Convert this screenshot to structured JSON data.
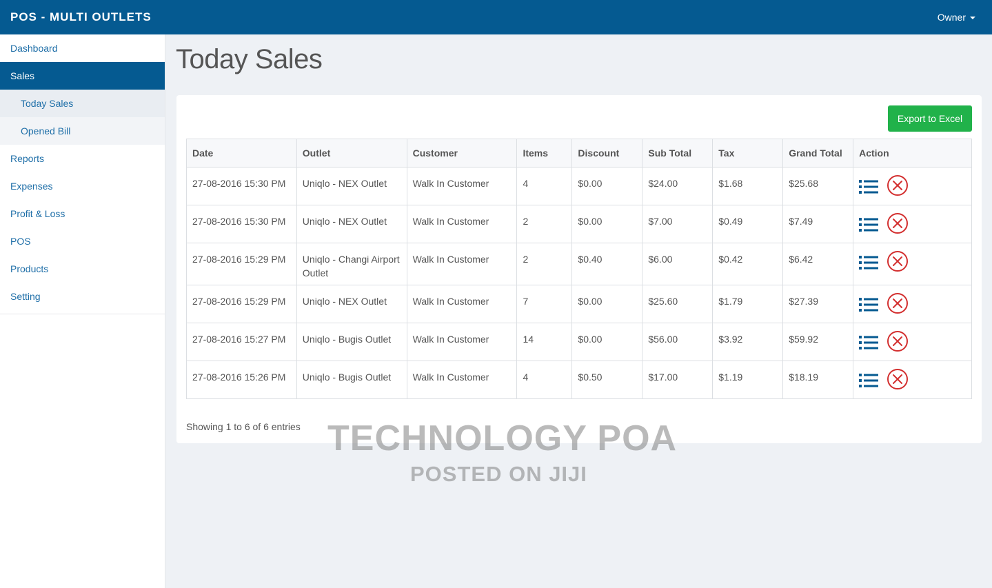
{
  "header": {
    "brand": "POS - MULTI OUTLETS",
    "user": "Owner"
  },
  "sidebar": {
    "items": [
      {
        "label": "Dashboard"
      },
      {
        "label": "Sales"
      },
      {
        "label": "Today Sales"
      },
      {
        "label": "Opened Bill"
      },
      {
        "label": "Reports"
      },
      {
        "label": "Expenses"
      },
      {
        "label": "Profit & Loss"
      },
      {
        "label": "POS"
      },
      {
        "label": "Products"
      },
      {
        "label": "Setting"
      }
    ]
  },
  "main": {
    "title": "Today Sales",
    "export_label": "Export to Excel",
    "table": {
      "headers": [
        "Date",
        "Outlet",
        "Customer",
        "Items",
        "Discount",
        "Sub Total",
        "Tax",
        "Grand Total",
        "Action"
      ],
      "rows": [
        [
          "27-08-2016 15:30 PM",
          "Uniqlo - NEX Outlet",
          "Walk In Customer",
          "4",
          "$0.00",
          "$24.00",
          "$1.68",
          "$25.68"
        ],
        [
          "27-08-2016 15:30 PM",
          "Uniqlo - NEX Outlet",
          "Walk In Customer",
          "2",
          "$0.00",
          "$7.00",
          "$0.49",
          "$7.49"
        ],
        [
          "27-08-2016 15:29 PM",
          "Uniqlo - Changi Airport Outlet",
          "Walk In Customer",
          "2",
          "$0.40",
          "$6.00",
          "$0.42",
          "$6.42"
        ],
        [
          "27-08-2016 15:29 PM",
          "Uniqlo - NEX Outlet",
          "Walk In Customer",
          "7",
          "$0.00",
          "$25.60",
          "$1.79",
          "$27.39"
        ],
        [
          "27-08-2016 15:27 PM",
          "Uniqlo - Bugis Outlet",
          "Walk In Customer",
          "14",
          "$0.00",
          "$56.00",
          "$3.92",
          "$59.92"
        ],
        [
          "27-08-2016 15:26 PM",
          "Uniqlo - Bugis Outlet",
          "Walk In Customer",
          "4",
          "$0.50",
          "$17.00",
          "$1.19",
          "$18.19"
        ]
      ]
    },
    "showing": "Showing 1 to 6 of 6 entries"
  },
  "watermark": {
    "line1": "TECHNOLOGY POA",
    "line2": "POSTED ON JIJI"
  },
  "icons": {
    "detail": "list-icon",
    "delete": "close-circle-icon"
  },
  "colors": {
    "header_bg": "#055a91",
    "export_button": "#21b24a",
    "delete_icon": "#d32f2f",
    "list_icon": "#055a91"
  }
}
